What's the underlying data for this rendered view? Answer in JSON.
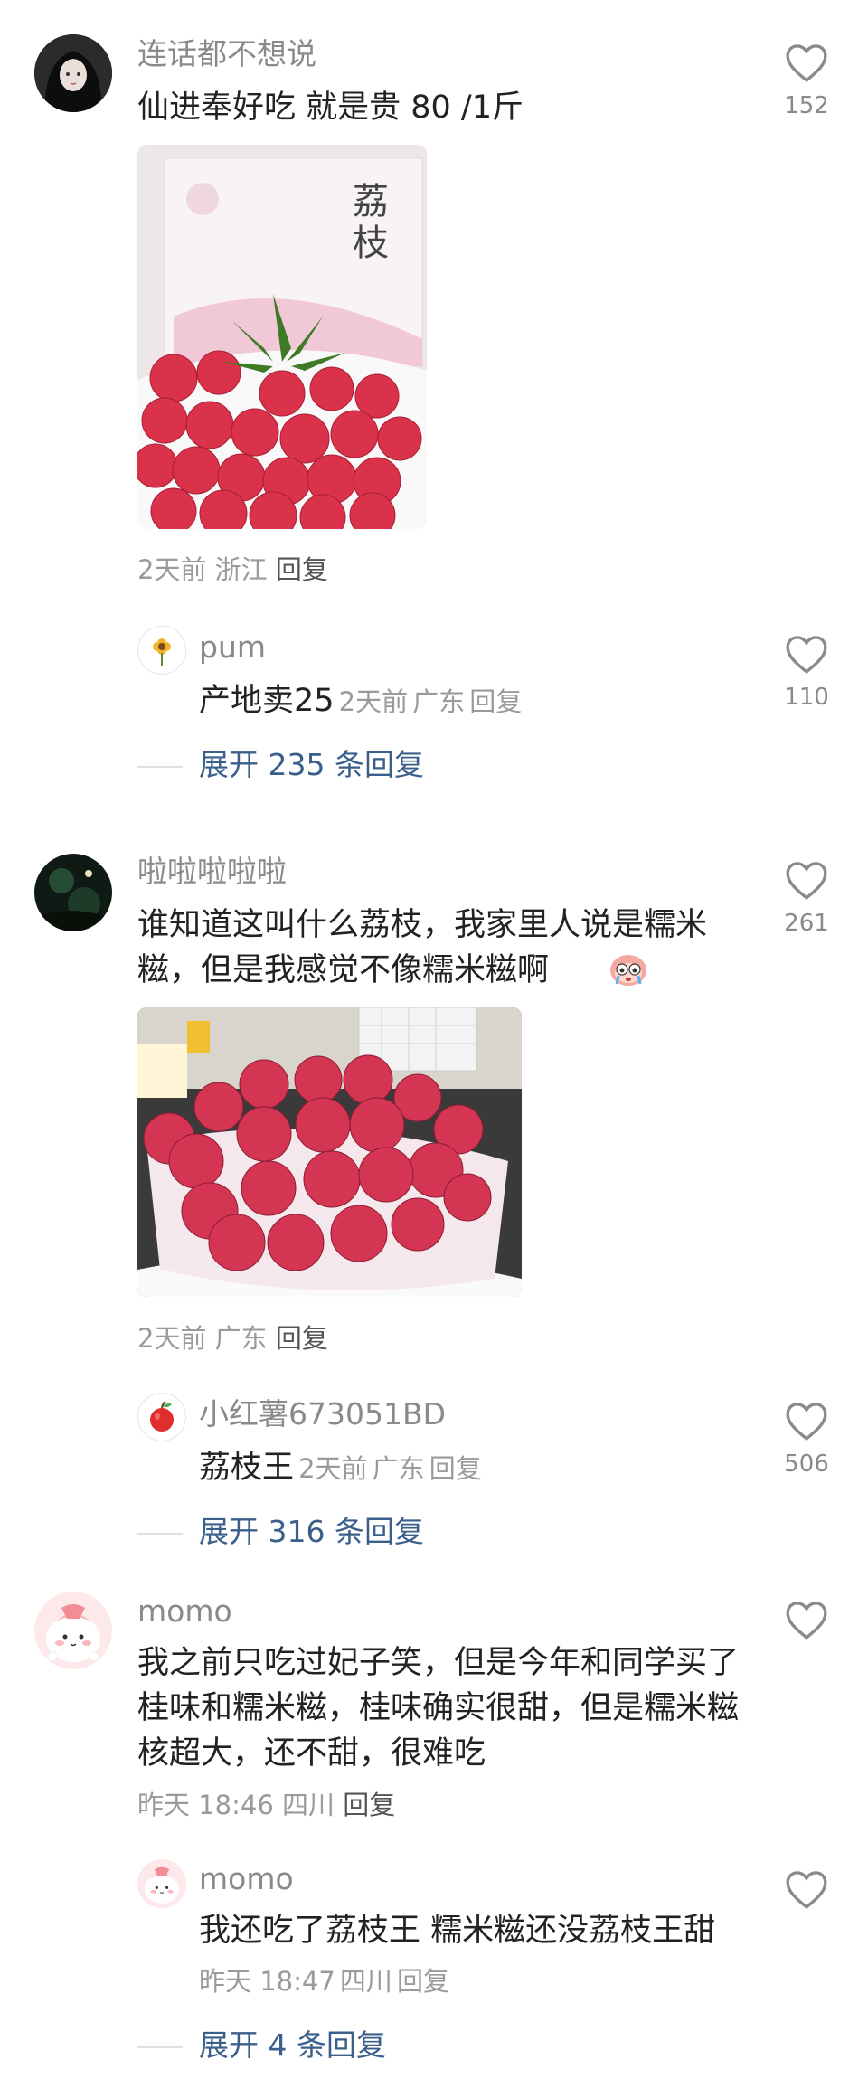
{
  "comments": [
    {
      "user": "连话都不想说",
      "text": "仙进奉好吃 就是贵 80 /1斤",
      "likes": "152",
      "time": "2天前",
      "location": "浙江",
      "reply_label": "回复",
      "photo_box_text": "荔枝",
      "reply": {
        "user": "pum",
        "text": "产地卖25",
        "time": "2天前",
        "location": "广东",
        "reply_label": "回复",
        "likes": "110"
      },
      "expand": "展开 235 条回复"
    },
    {
      "user": "啦啦啦啦啦",
      "text": "谁知道这叫什么荔枝，我家里人说是糯米糍，但是我感觉不像糯米糍啊",
      "likes": "261",
      "time": "2天前",
      "location": "广东",
      "reply_label": "回复",
      "reply": {
        "user": "小红薯673051BD",
        "text": "荔枝王",
        "time": "2天前",
        "location": "广东",
        "reply_label": "回复",
        "likes": "506"
      },
      "expand": "展开 316 条回复"
    },
    {
      "user": "momo",
      "text": "我之前只吃过妃子笑，但是今年和同学买了桂味和糯米糍，桂味确实很甜，但是糯米糍核超大，还不甜，很难吃",
      "likes": "",
      "time": "昨天 18:46",
      "location": "四川",
      "reply_label": "回复",
      "reply": {
        "user": "momo",
        "text": "我还吃了荔枝王 糯米糍还没荔枝王甜",
        "time": "昨天 18:47",
        "location": "四川",
        "reply_label": "回复",
        "likes": ""
      },
      "expand": "展开 4 条回复"
    }
  ],
  "colors": {
    "accent": "#3a5f8a",
    "muted": "#9a9a9a",
    "lychee": "#d9324a"
  }
}
